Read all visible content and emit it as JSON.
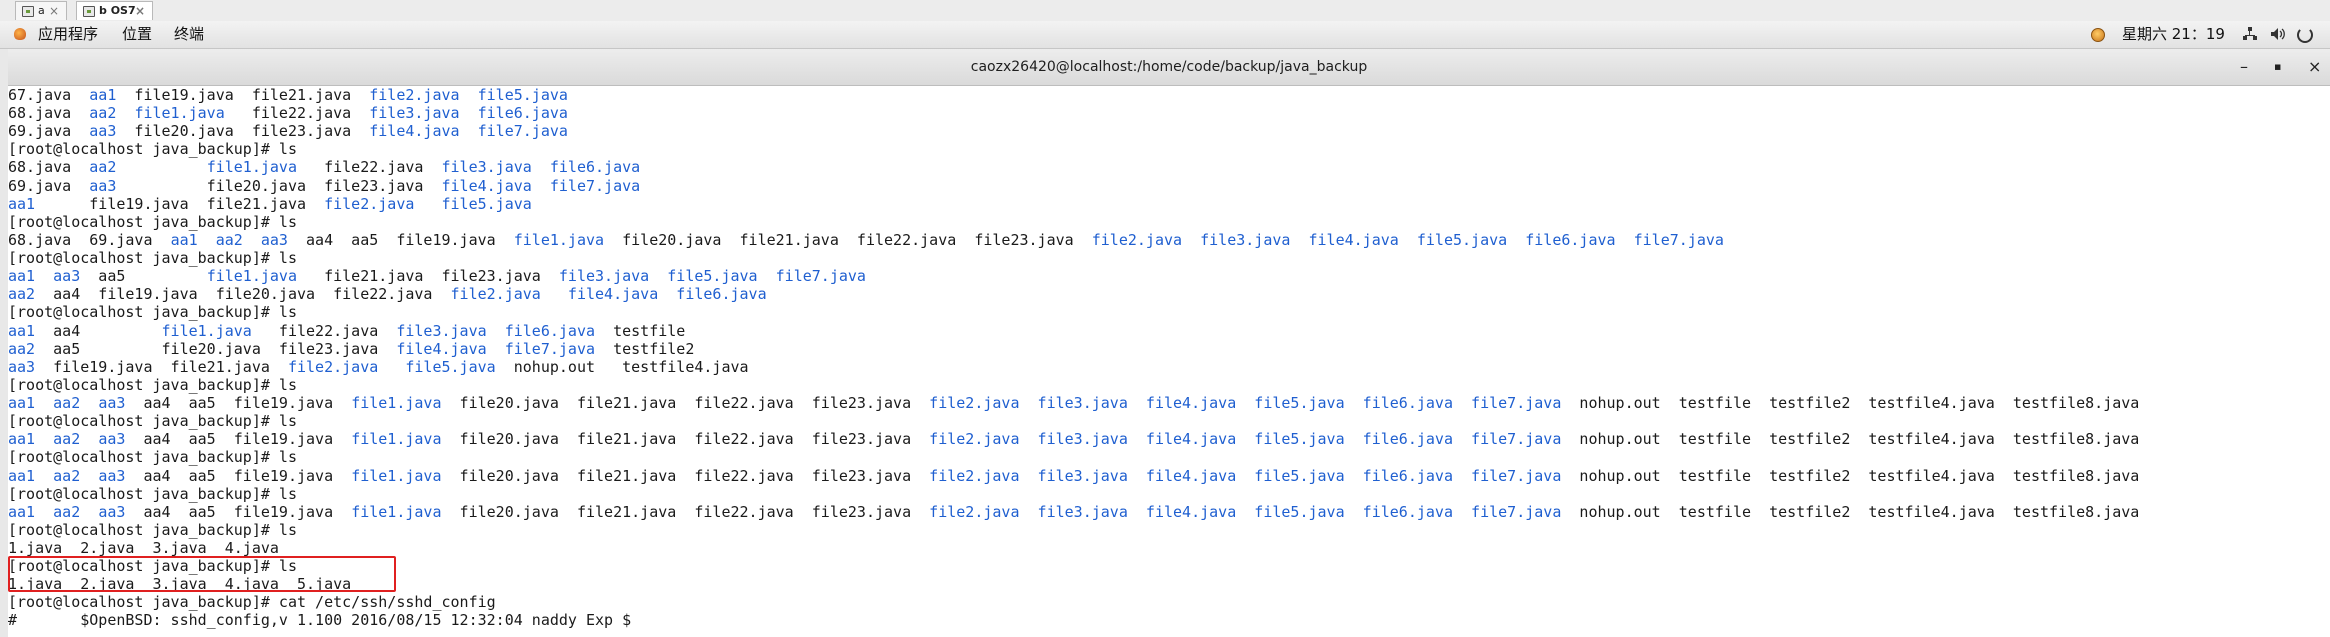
{
  "host_tabs": [
    {
      "label": "a",
      "close": "×"
    },
    {
      "label": "b OS7",
      "close": "×"
    }
  ],
  "panel": {
    "menus": [
      "应用程序",
      "位置",
      "终端"
    ],
    "clock": "星期六 21：19",
    "icons": [
      "app-menu-icon",
      "clock-icon",
      "network-icon",
      "volume-icon",
      "power-icon"
    ]
  },
  "window": {
    "title": "caozx26420@localhost:/home/code/backup/java_backup",
    "minimize": "–",
    "maximize": "▪",
    "close": "×"
  },
  "colors": {
    "directory_blue": "#1f5fd0",
    "highlight_red": "#e02020"
  },
  "terminal": {
    "lines": [
      [
        [
          "67.java  ",
          "n"
        ],
        [
          "aa1",
          "b"
        ],
        [
          "  file19.java  file21.java  ",
          "n"
        ],
        [
          "file2.java",
          "b"
        ],
        [
          "  ",
          "n"
        ],
        [
          "file5.java",
          "b"
        ]
      ],
      [
        [
          "68.java  ",
          "n"
        ],
        [
          "aa2",
          "b"
        ],
        [
          "  ",
          "n"
        ],
        [
          "file1.java",
          "b"
        ],
        [
          "   file22.java  ",
          "n"
        ],
        [
          "file3.java",
          "b"
        ],
        [
          "  ",
          "n"
        ],
        [
          "file6.java",
          "b"
        ]
      ],
      [
        [
          "69.java  ",
          "n"
        ],
        [
          "aa3",
          "b"
        ],
        [
          "  file20.java  file23.java  ",
          "n"
        ],
        [
          "file4.java",
          "b"
        ],
        [
          "  ",
          "n"
        ],
        [
          "file7.java",
          "b"
        ]
      ],
      [
        [
          "[root@localhost java_backup]# ls",
          "n"
        ]
      ],
      [
        [
          "68.java  ",
          "n"
        ],
        [
          "aa2",
          "b"
        ],
        [
          "          ",
          "n"
        ],
        [
          "file1.java",
          "b"
        ],
        [
          "   file22.java  ",
          "n"
        ],
        [
          "file3.java",
          "b"
        ],
        [
          "  ",
          "n"
        ],
        [
          "file6.java",
          "b"
        ]
      ],
      [
        [
          "69.java  ",
          "n"
        ],
        [
          "aa3",
          "b"
        ],
        [
          "          file20.java  file23.java  ",
          "n"
        ],
        [
          "file4.java",
          "b"
        ],
        [
          "  ",
          "n"
        ],
        [
          "file7.java",
          "b"
        ]
      ],
      [
        [
          "aa1",
          "b"
        ],
        [
          "      file19.java  file21.java  ",
          "n"
        ],
        [
          "file2.java",
          "b"
        ],
        [
          "   ",
          "n"
        ],
        [
          "file5.java",
          "b"
        ]
      ],
      [
        [
          "[root@localhost java_backup]# ls",
          "n"
        ]
      ],
      [
        [
          "68.java  69.java  ",
          "n"
        ],
        [
          "aa1",
          "b"
        ],
        [
          "  ",
          "n"
        ],
        [
          "aa2",
          "b"
        ],
        [
          "  ",
          "n"
        ],
        [
          "aa3",
          "b"
        ],
        [
          "  aa4  aa5  file19.java  ",
          "n"
        ],
        [
          "file1.java",
          "b"
        ],
        [
          "  file20.java  file21.java  file22.java  file23.java  ",
          "n"
        ],
        [
          "file2.java",
          "b"
        ],
        [
          "  ",
          "n"
        ],
        [
          "file3.java",
          "b"
        ],
        [
          "  ",
          "n"
        ],
        [
          "file4.java",
          "b"
        ],
        [
          "  ",
          "n"
        ],
        [
          "file5.java",
          "b"
        ],
        [
          "  ",
          "n"
        ],
        [
          "file6.java",
          "b"
        ],
        [
          "  ",
          "n"
        ],
        [
          "file7.java",
          "b"
        ]
      ],
      [
        [
          "[root@localhost java_backup]# ls",
          "n"
        ]
      ],
      [
        [
          "aa1",
          "b"
        ],
        [
          "  ",
          "n"
        ],
        [
          "aa3",
          "b"
        ],
        [
          "  aa5         ",
          "n"
        ],
        [
          "file1.java",
          "b"
        ],
        [
          "   file21.java  file23.java  ",
          "n"
        ],
        [
          "file3.java",
          "b"
        ],
        [
          "  ",
          "n"
        ],
        [
          "file5.java",
          "b"
        ],
        [
          "  ",
          "n"
        ],
        [
          "file7.java",
          "b"
        ]
      ],
      [
        [
          "aa2",
          "b"
        ],
        [
          "  aa4  file19.java  file20.java  file22.java  ",
          "n"
        ],
        [
          "file2.java",
          "b"
        ],
        [
          "   ",
          "n"
        ],
        [
          "file4.java",
          "b"
        ],
        [
          "  ",
          "n"
        ],
        [
          "file6.java",
          "b"
        ]
      ],
      [
        [
          "[root@localhost java_backup]# ls",
          "n"
        ]
      ],
      [
        [
          "aa1",
          "b"
        ],
        [
          "  aa4         ",
          "n"
        ],
        [
          "file1.java",
          "b"
        ],
        [
          "   file22.java  ",
          "n"
        ],
        [
          "file3.java",
          "b"
        ],
        [
          "  ",
          "n"
        ],
        [
          "file6.java",
          "b"
        ],
        [
          "  testfile",
          "n"
        ]
      ],
      [
        [
          "aa2",
          "b"
        ],
        [
          "  aa5         file20.java  file23.java  ",
          "n"
        ],
        [
          "file4.java",
          "b"
        ],
        [
          "  ",
          "n"
        ],
        [
          "file7.java",
          "b"
        ],
        [
          "  testfile2",
          "n"
        ]
      ],
      [
        [
          "aa3",
          "b"
        ],
        [
          "  file19.java  file21.java  ",
          "n"
        ],
        [
          "file2.java",
          "b"
        ],
        [
          "   ",
          "n"
        ],
        [
          "file5.java",
          "b"
        ],
        [
          "  nohup.out   testfile4.java",
          "n"
        ]
      ],
      [
        [
          "[root@localhost java_backup]# ls",
          "n"
        ]
      ],
      [
        [
          "aa1",
          "b"
        ],
        [
          "  ",
          "n"
        ],
        [
          "aa2",
          "b"
        ],
        [
          "  ",
          "n"
        ],
        [
          "aa3",
          "b"
        ],
        [
          "  aa4  aa5  file19.java  ",
          "n"
        ],
        [
          "file1.java",
          "b"
        ],
        [
          "  file20.java  file21.java  file22.java  file23.java  ",
          "n"
        ],
        [
          "file2.java",
          "b"
        ],
        [
          "  ",
          "n"
        ],
        [
          "file3.java",
          "b"
        ],
        [
          "  ",
          "n"
        ],
        [
          "file4.java",
          "b"
        ],
        [
          "  ",
          "n"
        ],
        [
          "file5.java",
          "b"
        ],
        [
          "  ",
          "n"
        ],
        [
          "file6.java",
          "b"
        ],
        [
          "  ",
          "n"
        ],
        [
          "file7.java",
          "b"
        ],
        [
          "  nohup.out  testfile  testfile2  testfile4.java  testfile8.java",
          "n"
        ]
      ],
      [
        [
          "[root@localhost java_backup]# ls",
          "n"
        ]
      ],
      [
        [
          "aa1",
          "b"
        ],
        [
          "  ",
          "n"
        ],
        [
          "aa2",
          "b"
        ],
        [
          "  ",
          "n"
        ],
        [
          "aa3",
          "b"
        ],
        [
          "  aa4  aa5  file19.java  ",
          "n"
        ],
        [
          "file1.java",
          "b"
        ],
        [
          "  file20.java  file21.java  file22.java  file23.java  ",
          "n"
        ],
        [
          "file2.java",
          "b"
        ],
        [
          "  ",
          "n"
        ],
        [
          "file3.java",
          "b"
        ],
        [
          "  ",
          "n"
        ],
        [
          "file4.java",
          "b"
        ],
        [
          "  ",
          "n"
        ],
        [
          "file5.java",
          "b"
        ],
        [
          "  ",
          "n"
        ],
        [
          "file6.java",
          "b"
        ],
        [
          "  ",
          "n"
        ],
        [
          "file7.java",
          "b"
        ],
        [
          "  nohup.out  testfile  testfile2  testfile4.java  testfile8.java",
          "n"
        ]
      ],
      [
        [
          "[root@localhost java_backup]# ls",
          "n"
        ]
      ],
      [
        [
          "aa1",
          "b"
        ],
        [
          "  ",
          "n"
        ],
        [
          "aa2",
          "b"
        ],
        [
          "  ",
          "n"
        ],
        [
          "aa3",
          "b"
        ],
        [
          "  aa4  aa5  file19.java  ",
          "n"
        ],
        [
          "file1.java",
          "b"
        ],
        [
          "  file20.java  file21.java  file22.java  file23.java  ",
          "n"
        ],
        [
          "file2.java",
          "b"
        ],
        [
          "  ",
          "n"
        ],
        [
          "file3.java",
          "b"
        ],
        [
          "  ",
          "n"
        ],
        [
          "file4.java",
          "b"
        ],
        [
          "  ",
          "n"
        ],
        [
          "file5.java",
          "b"
        ],
        [
          "  ",
          "n"
        ],
        [
          "file6.java",
          "b"
        ],
        [
          "  ",
          "n"
        ],
        [
          "file7.java",
          "b"
        ],
        [
          "  nohup.out  testfile  testfile2  testfile4.java  testfile8.java",
          "n"
        ]
      ],
      [
        [
          "[root@localhost java_backup]# ls",
          "n"
        ]
      ],
      [
        [
          "aa1",
          "b"
        ],
        [
          "  ",
          "n"
        ],
        [
          "aa2",
          "b"
        ],
        [
          "  ",
          "n"
        ],
        [
          "aa3",
          "b"
        ],
        [
          "  aa4  aa5  file19.java  ",
          "n"
        ],
        [
          "file1.java",
          "b"
        ],
        [
          "  file20.java  file21.java  file22.java  file23.java  ",
          "n"
        ],
        [
          "file2.java",
          "b"
        ],
        [
          "  ",
          "n"
        ],
        [
          "file3.java",
          "b"
        ],
        [
          "  ",
          "n"
        ],
        [
          "file4.java",
          "b"
        ],
        [
          "  ",
          "n"
        ],
        [
          "file5.java",
          "b"
        ],
        [
          "  ",
          "n"
        ],
        [
          "file6.java",
          "b"
        ],
        [
          "  ",
          "n"
        ],
        [
          "file7.java",
          "b"
        ],
        [
          "  nohup.out  testfile  testfile2  testfile4.java  testfile8.java",
          "n"
        ]
      ],
      [
        [
          "[root@localhost java_backup]# ls",
          "n"
        ]
      ],
      [
        [
          "1.java  2.java  3.java  4.java",
          "n"
        ]
      ],
      [
        [
          "[root@localhost java_backup]# ls",
          "n"
        ]
      ],
      [
        [
          "1.java  2.java  3.java  4.java  5.java",
          "n"
        ]
      ],
      [
        [
          "[root@localhost java_backup]# cat /etc/ssh/sshd_config",
          "n"
        ]
      ],
      [
        [
          "#       $OpenBSD: sshd_config,v 1.100 2016/08/15 12:32:04 naddy Exp $",
          "n"
        ]
      ]
    ]
  }
}
